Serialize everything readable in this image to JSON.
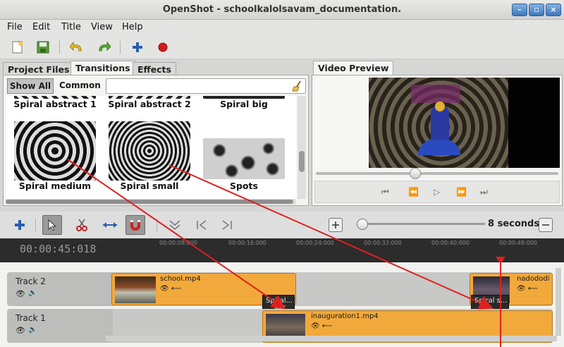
{
  "window": {
    "title": "OpenShot - schoolkalolsavam_documentation."
  },
  "menu": [
    "File",
    "Edit",
    "Title",
    "View",
    "Help"
  ],
  "left_tabs": [
    "Project Files",
    "Transitions",
    "Effects"
  ],
  "filters": {
    "show_all": "Show All",
    "common": "Common",
    "search_value": ""
  },
  "transitions": [
    {
      "label": "Spiral abstract 1"
    },
    {
      "label": "Spiral abstract 2"
    },
    {
      "label": "Spiral big"
    },
    {
      "label": "Spiral medium"
    },
    {
      "label": "Spiral small"
    },
    {
      "label": "Spots"
    }
  ],
  "preview": {
    "tab": "Video Preview",
    "seek_fraction": 0.41
  },
  "zoom": {
    "label": "8 seconds"
  },
  "timeline": {
    "timecode": "00:00:45:018",
    "ticks": [
      "00:00:08:000",
      "00:00:16:000",
      "00:00:24:000",
      "00:00:32:000",
      "00:00:40:000",
      "00:00:48:000"
    ]
  },
  "tracks": [
    {
      "name": "Track 2"
    },
    {
      "name": "Track 1"
    }
  ],
  "clips": {
    "school": "school.mp4",
    "nadododi": "nadododi",
    "inauguration": "inauguration1.mp4",
    "trans1": "Spiral...",
    "trans2": "Spiral s..."
  },
  "colors": {
    "clip": "#f2a93b",
    "arrow": "#e02020",
    "playhead": "#e02020",
    "record": "#d01c1c",
    "add": "#2a5db0"
  },
  "icons": [
    "new-project-icon",
    "save-project-icon",
    "undo-icon",
    "redo-icon",
    "import-icon",
    "record-icon",
    "add-track-icon",
    "select-arrow-icon",
    "razor-icon",
    "resize-icon",
    "snap-icon",
    "marker-icon",
    "jump-start-icon",
    "jump-end-icon",
    "zoom-in-icon",
    "zoom-out-icon",
    "broom-icon",
    "visible-icon",
    "audio-icon"
  ]
}
